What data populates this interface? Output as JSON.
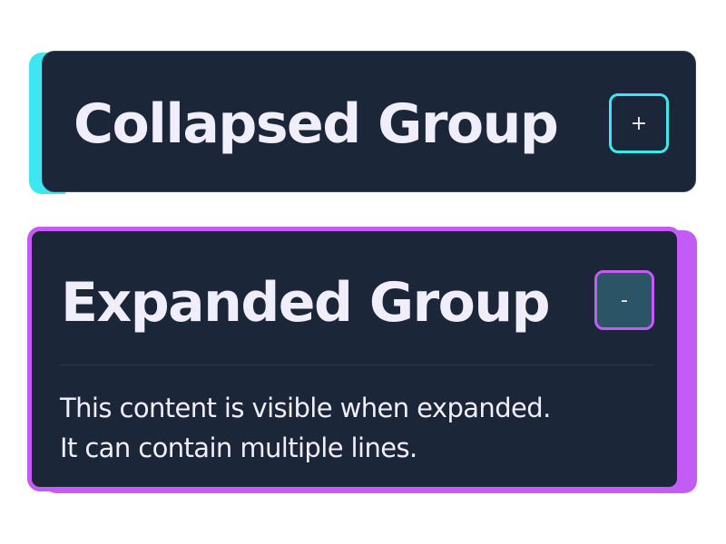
{
  "collapsed_group": {
    "title": "Collapsed Group",
    "toggle_label": "+",
    "accent_color": "#3ee6f0"
  },
  "expanded_group": {
    "title": "Expanded Group",
    "toggle_label": "-",
    "accent_color": "#c25cf5",
    "content_lines": [
      "This content is visible when expanded.",
      "It can contain multiple lines."
    ]
  },
  "colors": {
    "card_background": "#1b2638",
    "text": "#f1eefb"
  }
}
